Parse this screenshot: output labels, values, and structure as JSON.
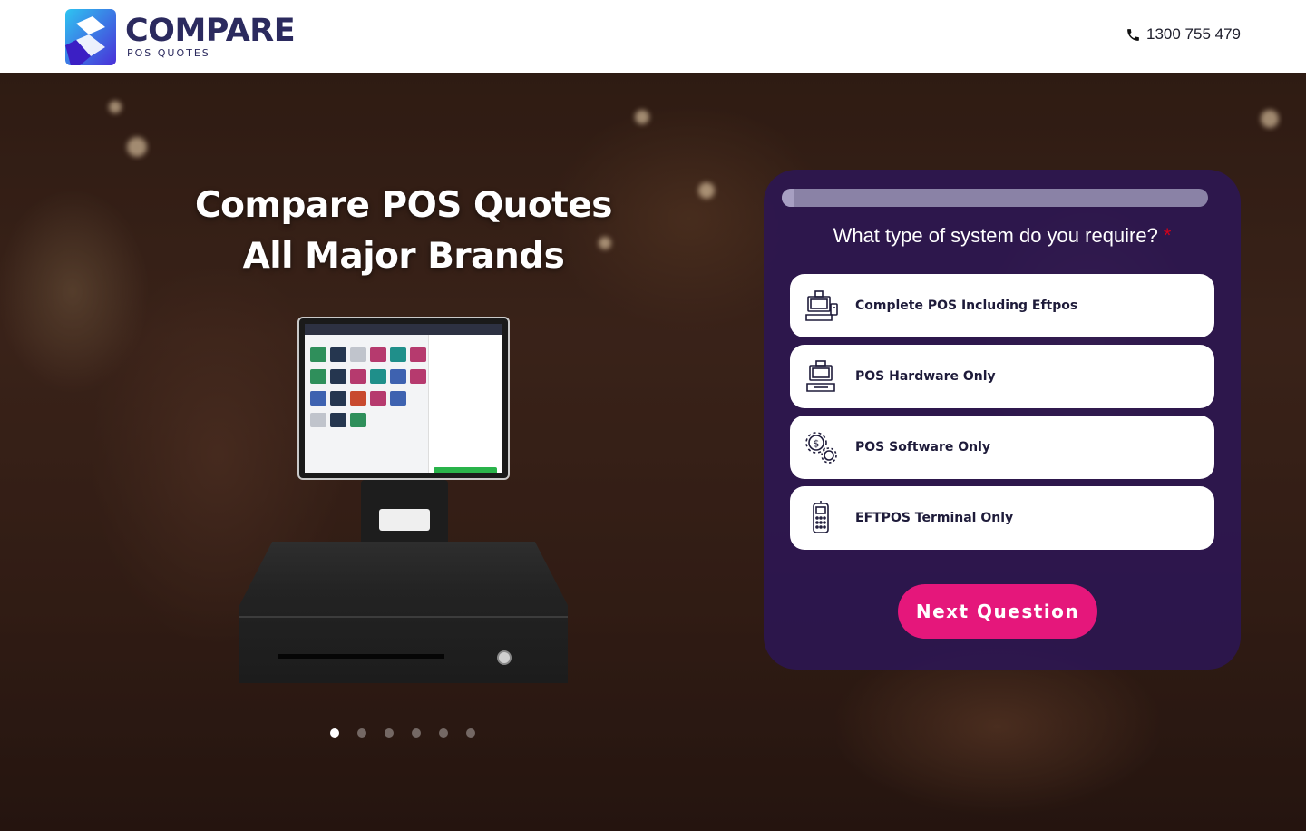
{
  "header": {
    "logo_word": "COMPARE",
    "logo_sub": "POS QUOTES",
    "phone": "1300 755 479"
  },
  "hero": {
    "title_line1": "Compare POS Quotes",
    "title_line2": "All Major Brands",
    "carousel_total": 6,
    "carousel_active": 1
  },
  "form": {
    "question": "What type of system do you require?",
    "required_mark": "*",
    "options": [
      {
        "label": "Complete POS Including Eftpos",
        "icon": "pos-terminal-icon"
      },
      {
        "label": "POS Hardware Only",
        "icon": "pos-hardware-icon"
      },
      {
        "label": "POS Software Only",
        "icon": "software-gears-icon"
      },
      {
        "label": "EFTPOS Terminal Only",
        "icon": "eftpos-terminal-icon"
      }
    ],
    "next_label": "Next Question"
  },
  "colors": {
    "brand_navy": "#2b2a5e",
    "card_bg": "#2c1652",
    "cta_pink": "#e5177b"
  }
}
